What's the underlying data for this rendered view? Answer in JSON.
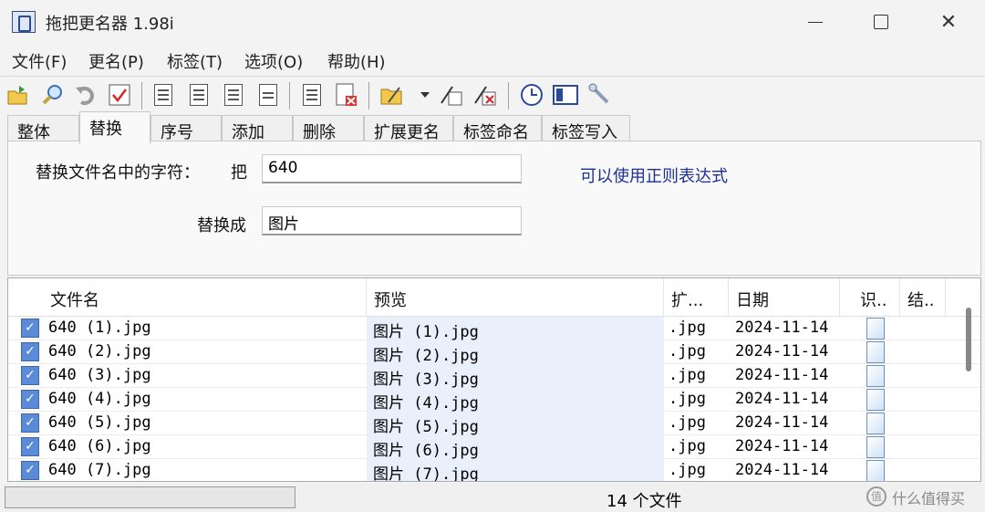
{
  "window": {
    "title": "拖把更名器 1.98i",
    "min_icon": "minimize-icon",
    "max_icon": "maximize-icon",
    "close_icon": "close-icon",
    "close_glyph": "✕"
  },
  "menu": [
    "文件(F)",
    "更名(P)",
    "标签(T)",
    "选项(O)",
    "帮助(H)"
  ],
  "tabs": [
    "整体",
    "替换",
    "序号",
    "添加",
    "删除",
    "扩展更名",
    "标签命名",
    "标签写入"
  ],
  "active_tab": "替换",
  "replace": {
    "find_label": "替换文件名中的字符：",
    "find_prefix": "把",
    "find_value": "640",
    "replace_label": "替换成",
    "replace_value": "图片",
    "regex_note": "可以使用正则表达式"
  },
  "columns": [
    "文件名",
    "预览",
    "扩...",
    "日期",
    "识..",
    "结.."
  ],
  "rows": [
    {
      "checked": true,
      "name": "640 (1).jpg",
      "preview": "图片 (1).jpg",
      "ext": ".jpg",
      "date": "2024-11-14"
    },
    {
      "checked": true,
      "name": "640 (2).jpg",
      "preview": "图片 (2).jpg",
      "ext": ".jpg",
      "date": "2024-11-14"
    },
    {
      "checked": true,
      "name": "640 (3).jpg",
      "preview": "图片 (3).jpg",
      "ext": ".jpg",
      "date": "2024-11-14"
    },
    {
      "checked": true,
      "name": "640 (4).jpg",
      "preview": "图片 (4).jpg",
      "ext": ".jpg",
      "date": "2024-11-14"
    },
    {
      "checked": true,
      "name": "640 (5).jpg",
      "preview": "图片 (5).jpg",
      "ext": ".jpg",
      "date": "2024-11-14"
    },
    {
      "checked": true,
      "name": "640 (6).jpg",
      "preview": "图片 (6).jpg",
      "ext": ".jpg",
      "date": "2024-11-14"
    },
    {
      "checked": true,
      "name": "640 (7).jpg",
      "preview": "图片 (7).jpg",
      "ext": ".jpg",
      "date": "2024-11-14"
    }
  ],
  "status": {
    "file_count": "14 个文件",
    "watermark": "什么值得买",
    "watermark_glyph": "值"
  },
  "toolbar_icons": [
    "open-folder-icon",
    "search-icon",
    "undo-icon",
    "check-icon",
    "doc-list-icon",
    "doc-edit-icon",
    "doc-down-icon",
    "doc-grid-icon",
    "doc-lines-icon",
    "doc-delete-icon",
    "folder-open-icon",
    "dropdown-icon",
    "rename-icon",
    "rename-delete-icon",
    "clock-icon",
    "panel-icon",
    "wand-icon"
  ],
  "colors": {
    "checkbox": "#5b8bd6",
    "preview_bg": "#e9f0fb",
    "regex_note": "#1a2f9a"
  }
}
